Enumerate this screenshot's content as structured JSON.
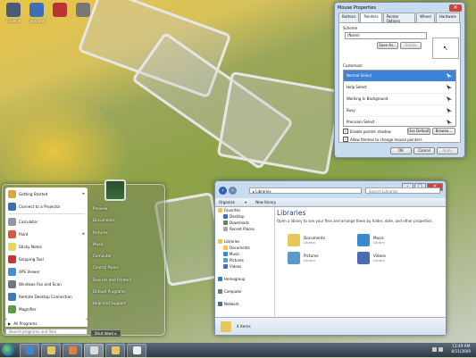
{
  "desktop": {
    "icons": [
      {
        "label": "Ravelox",
        "color": "#4a5a7a"
      },
      {
        "label": "Computer",
        "color": "#3b6fb6"
      },
      {
        "label": "",
        "color": "#b33"
      },
      {
        "label": "",
        "color": "#777"
      }
    ]
  },
  "mouse_properties": {
    "title": "Mouse Properties",
    "tabs": [
      "Buttons",
      "Pointers",
      "Pointer Options",
      "Wheel",
      "Hardware"
    ],
    "scheme_label": "Scheme",
    "scheme_value": "(None)",
    "save_as": "Save As...",
    "delete": "Delete",
    "customize_label": "Customize:",
    "pointers": [
      "Normal Select",
      "Help Select",
      "Working In Background",
      "Busy",
      "Precision Select"
    ],
    "enable_shadow": "Enable pointer shadow",
    "use_default": "Use Default",
    "browse": "Browse...",
    "allow_themes": "Allow themes to change mouse pointers",
    "ok": "OK",
    "cancel": "Cancel",
    "apply": "Apply"
  },
  "start_menu": {
    "items": [
      {
        "label": "Getting Started",
        "color": "#e0a53b",
        "arrow": true
      },
      {
        "label": "Connect to a Projector",
        "color": "#3b6fb6",
        "arrow": false
      },
      {
        "label": "Calculator",
        "color": "#8a9aa8",
        "arrow": false
      },
      {
        "label": "Paint",
        "color": "#d85a3a",
        "arrow": true
      },
      {
        "label": "Sticky Notes",
        "color": "#e8d65a",
        "arrow": false
      },
      {
        "label": "Snipping Tool",
        "color": "#c33",
        "arrow": false
      },
      {
        "label": "XPS Viewer",
        "color": "#4a8ad0",
        "arrow": false
      },
      {
        "label": "Windows Fax and Scan",
        "color": "#6a7a8a",
        "arrow": false
      },
      {
        "label": "Remote Desktop Connection",
        "color": "#3a7ab5",
        "arrow": false
      },
      {
        "label": "Magnifier",
        "color": "#5a9a4a",
        "arrow": false
      }
    ],
    "all_programs": "All Programs",
    "search_placeholder": "Search programs and files",
    "right_items": [
      "Preview",
      "Documents",
      "Pictures",
      "Music",
      "Computer",
      "Control Panel",
      "Devices and Printers",
      "Default Programs",
      "Help and Support"
    ],
    "shutdown": "Shut down"
  },
  "explorer": {
    "address": "Libraries",
    "search_placeholder": "Search Libraries",
    "organize": "Organize",
    "new_library": "New library",
    "nav": [
      {
        "label": "Favorites",
        "color": "#e8c75a",
        "indent": 0
      },
      {
        "label": "Desktop",
        "color": "#3b6fb6",
        "indent": 1
      },
      {
        "label": "Downloads",
        "color": "#5a8a5a",
        "indent": 1
      },
      {
        "label": "Recent Places",
        "color": "#aaa",
        "indent": 1
      },
      {
        "label": "",
        "color": "",
        "indent": 0
      },
      {
        "label": "Libraries",
        "color": "#e8c75a",
        "indent": 0
      },
      {
        "label": "Documents",
        "color": "#e8c75a",
        "indent": 1
      },
      {
        "label": "Music",
        "color": "#3a8ad0",
        "indent": 1
      },
      {
        "label": "Pictures",
        "color": "#5a9aca",
        "indent": 1
      },
      {
        "label": "Videos",
        "color": "#4a6ab5",
        "indent": 1
      },
      {
        "label": "",
        "color": "",
        "indent": 0
      },
      {
        "label": "Homegroup",
        "color": "#3a7ab5",
        "indent": 0
      },
      {
        "label": "",
        "color": "",
        "indent": 0
      },
      {
        "label": "Computer",
        "color": "#6a7a8a",
        "indent": 0
      },
      {
        "label": "",
        "color": "",
        "indent": 0
      },
      {
        "label": "Network",
        "color": "#4a6a8a",
        "indent": 0
      }
    ],
    "title": "Libraries",
    "subtitle": "Open a library to see your files and arrange them by folder, date, and other properties.",
    "libraries": [
      {
        "name": "Documents",
        "type": "Library",
        "color": "#e8c75a"
      },
      {
        "name": "Music",
        "type": "Library",
        "color": "#3a8ad0"
      },
      {
        "name": "Pictures",
        "type": "Library",
        "color": "#5a9aca"
      },
      {
        "name": "Videos",
        "type": "Library",
        "color": "#4a6ab5"
      }
    ],
    "status": "4 items"
  },
  "taskbar": {
    "time": "11:49 AM",
    "date": "8/11/2009"
  }
}
